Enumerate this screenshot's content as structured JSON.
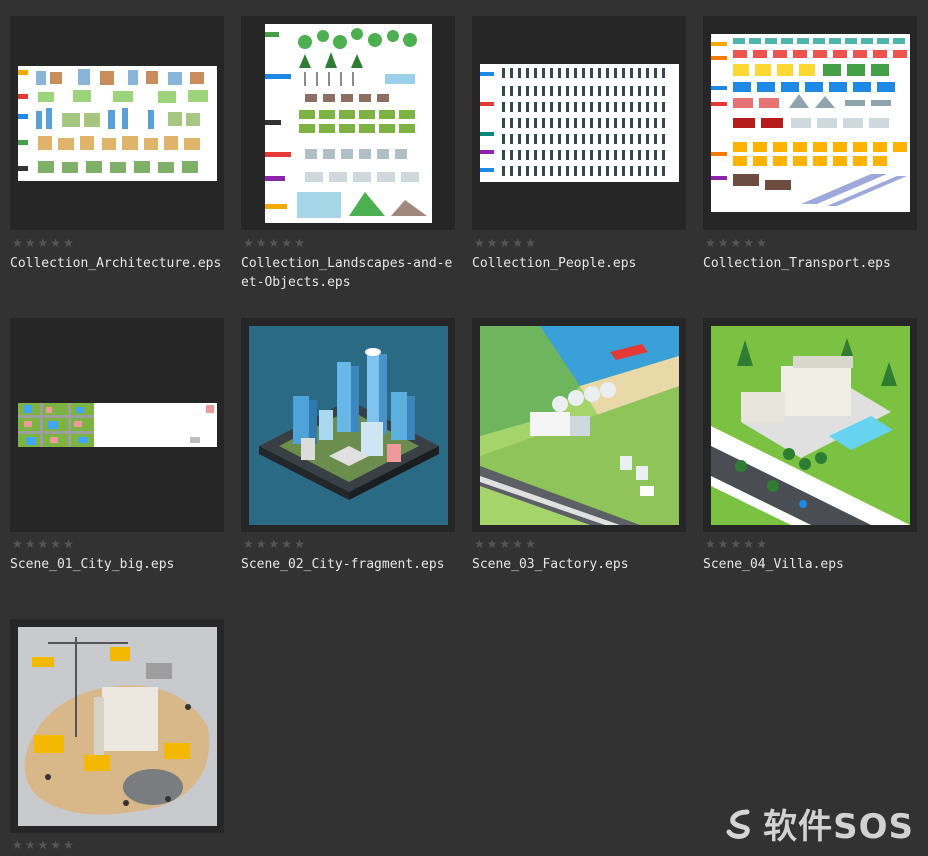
{
  "files": [
    {
      "name": "Collection_Architecture.eps",
      "rating": 0
    },
    {
      "name": "Collection_Landscapes-and-eet-Objects.eps",
      "rating": 0
    },
    {
      "name": "Collection_People.eps",
      "rating": 0
    },
    {
      "name": "Collection_Transport.eps",
      "rating": 0
    },
    {
      "name": "Scene_01_City_big.eps",
      "rating": 0
    },
    {
      "name": "Scene_02_City-fragment.eps",
      "rating": 0
    },
    {
      "name": "Scene_03_Factory.eps",
      "rating": 0
    },
    {
      "name": "Scene_04_Villa.eps",
      "rating": 0
    },
    {
      "name": "",
      "rating": 0
    }
  ],
  "star_glyph": "★",
  "watermark": {
    "text": "软件SOS",
    "icon": "swirl-logo-icon"
  },
  "colors": {
    "background": "#323232",
    "tile": "#262626",
    "star_empty": "#555555",
    "label": "#e6e6e6"
  }
}
